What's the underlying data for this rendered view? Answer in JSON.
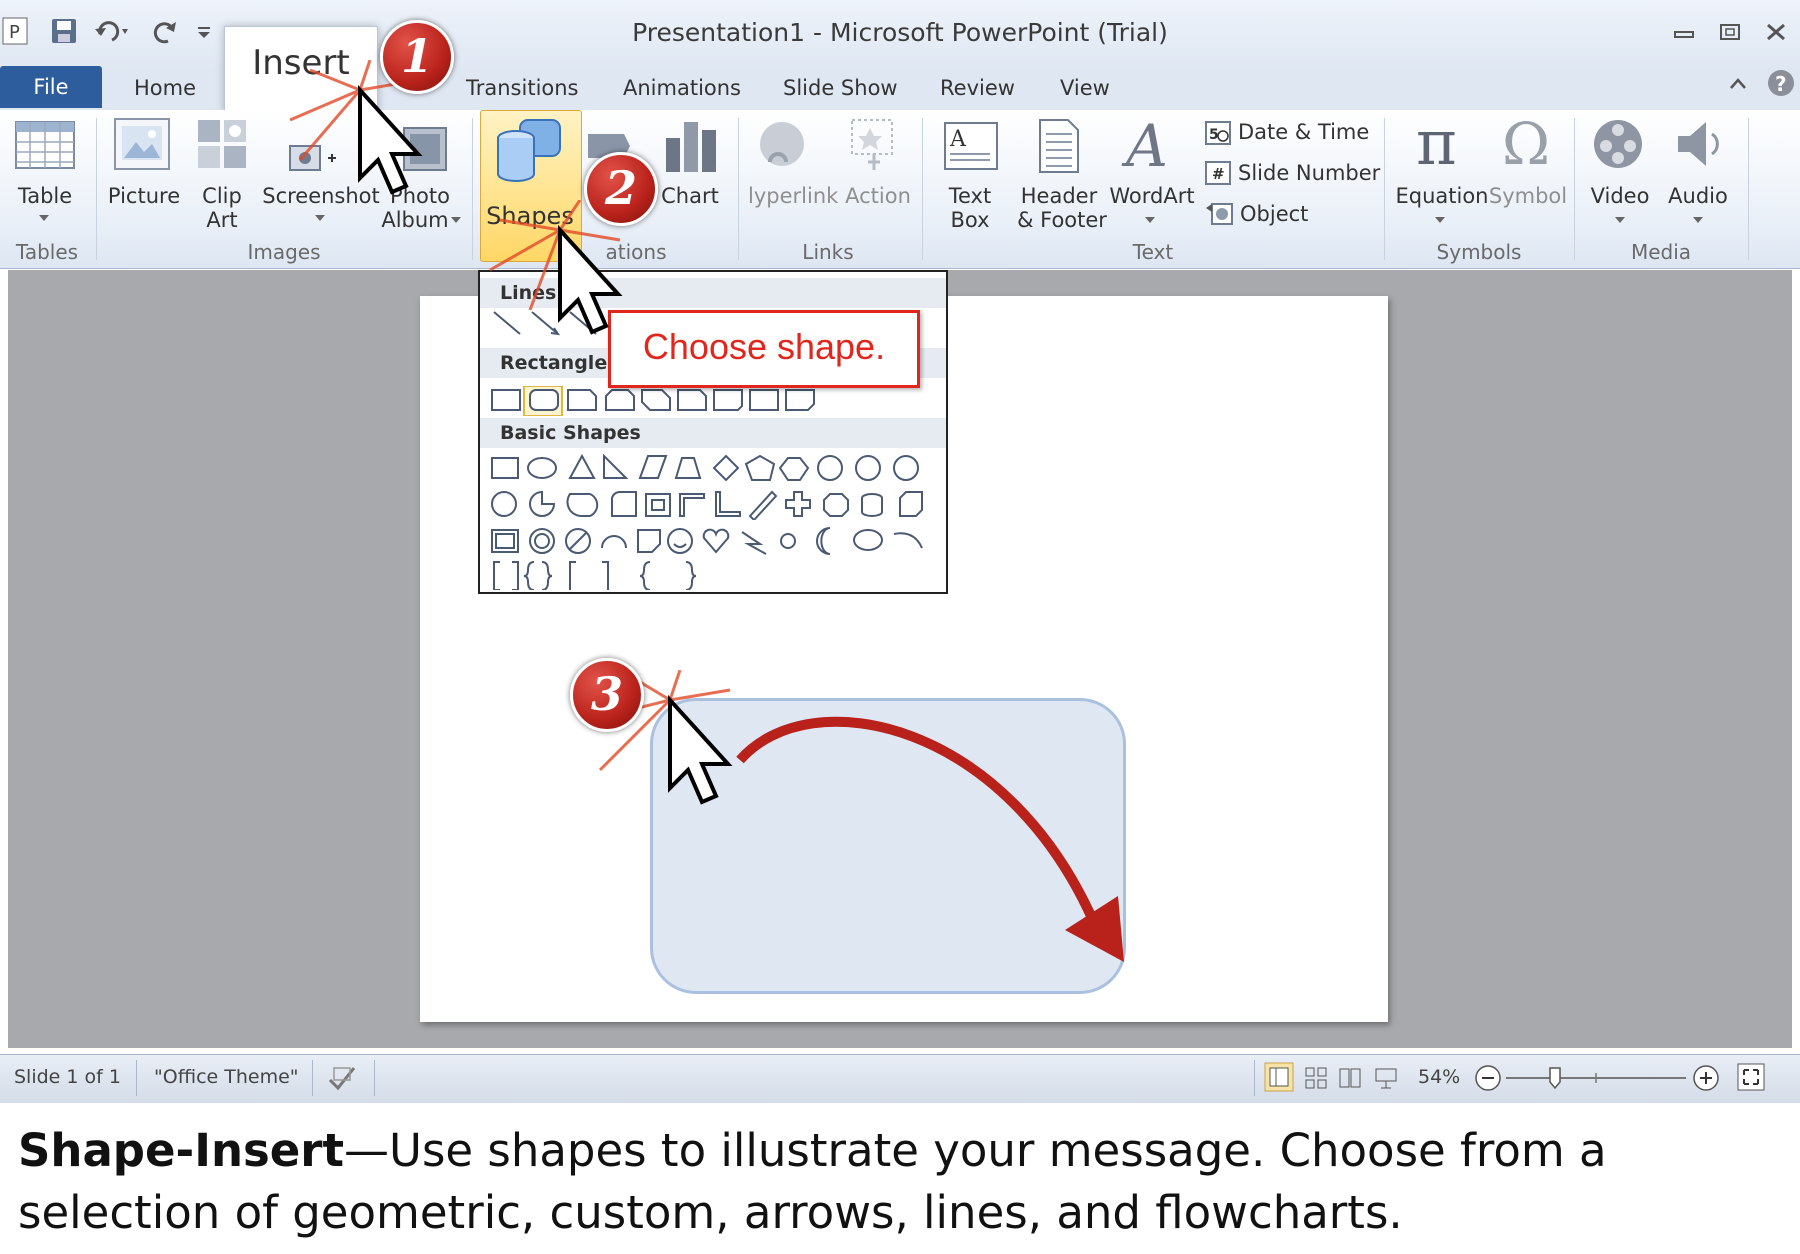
{
  "window": {
    "title": "Presentation1  -  Microsoft PowerPoint (Trial)",
    "controls": [
      "minimize-icon",
      "restore-icon",
      "close-icon"
    ]
  },
  "tabs": {
    "file": "File",
    "home": "Home",
    "insert": "Insert",
    "transitions": "Transitions",
    "animations": "Animations",
    "slide_show": "Slide Show",
    "review": "Review",
    "view": "View"
  },
  "ribbon": {
    "tables": {
      "label": "Tables",
      "table": "Table"
    },
    "images": {
      "label": "Images",
      "picture": "Picture",
      "clip_art_1": "Clip",
      "clip_art_2": "Art",
      "screenshot": "Screenshot",
      "photo_album_1": "Photo",
      "photo_album_2": "Album"
    },
    "illustrations": {
      "label": "ations",
      "shapes": "Shapes",
      "chart": "Chart"
    },
    "links": {
      "label": "Links",
      "hyperlink": "lyperlink",
      "action": "Action"
    },
    "text": {
      "label": "Text",
      "text_box_1": "Text",
      "text_box_2": "Box",
      "header_footer_1": "Header",
      "header_footer_2": "& Footer",
      "wordart": "WordArt",
      "date_time": "Date & Time",
      "slide_number": "Slide Number",
      "object": "Object"
    },
    "symbols": {
      "label": "Symbols",
      "equation": "Equation",
      "symbol": "Symbol"
    },
    "media": {
      "label": "Media",
      "video": "Video",
      "audio": "Audio"
    }
  },
  "gallery": {
    "lines": "Lines",
    "rectangles": "Rectangles",
    "basic_shapes": "Basic Shapes"
  },
  "callout": {
    "text": "Choose shape."
  },
  "steps": {
    "one": "1",
    "two": "2",
    "three": "3"
  },
  "status": {
    "slide": "Slide 1 of 1",
    "theme": "\"Office Theme\"",
    "zoom": "54%",
    "zoom_level_percent": 54
  },
  "caption": {
    "bold": "Shape-Insert",
    "text": "—Use shapes to illustrate your message.  Choose from a selection of geometric, custom, arrows, lines, and flowcharts."
  },
  "colors": {
    "accent_red": "#e0261d",
    "file_tab": "#2e5d9e",
    "shapes_highlight": "#ffd766",
    "drawn_shape_fill": "#dfe7f3"
  }
}
